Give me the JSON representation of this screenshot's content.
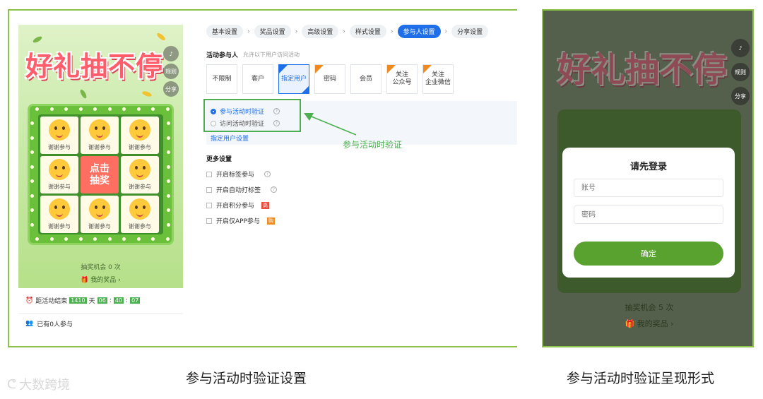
{
  "phone": {
    "title": "好礼抽不停",
    "side_buttons": [
      "♪",
      "规则",
      "分享"
    ],
    "cells": [
      "谢谢参与",
      "谢谢参与",
      "谢谢参与",
      "谢谢参与",
      "谢谢参与",
      "谢谢参与",
      "谢谢参与",
      "谢谢参与"
    ],
    "center_button": "点击抽奖",
    "chance_text": "抽奖机会 0 次",
    "my_prize": "我的奖品",
    "countdown_label": "距活动结束",
    "countdown": {
      "days": "1410",
      "day_unit": "天",
      "h": "06",
      "m": "40",
      "s": "07"
    },
    "participants": "已有0人参与"
  },
  "settings": {
    "steps": [
      "基本设置",
      "奖品设置",
      "高级设置",
      "样式设置",
      "参与人设置",
      "分享设置"
    ],
    "active_step": 4,
    "participants_label": "活动参与人",
    "participants_hint": "允许以下用户访问活动",
    "options": [
      "不限制",
      "客户",
      "指定用户",
      "密码",
      "会员",
      "关注公众号",
      "关注企业微信"
    ],
    "option_lines": [
      [
        "不限制"
      ],
      [
        "客户"
      ],
      [
        "指定用户"
      ],
      [
        "密码"
      ],
      [
        "会员"
      ],
      [
        "关注",
        "公众号"
      ],
      [
        "关注",
        "企业微信"
      ]
    ],
    "radios": [
      "参与活动时验证",
      "访问活动时验证"
    ],
    "link": "指定用户设置",
    "annotation": "参与活动时验证",
    "more_label": "更多设置",
    "checks": [
      "开启标签参与",
      "开启自动打标签",
      "开启积分参与",
      "开启仅APP参与"
    ],
    "badges": {
      "points": "高",
      "app": "购"
    },
    "colors": {
      "primary": "#1e6fe8",
      "highlight": "#4caf50",
      "tag": "#f0891e"
    }
  },
  "right": {
    "title": "好礼抽不停",
    "side_buttons": [
      "♪",
      "规则",
      "分享"
    ],
    "login_title": "请先登录",
    "account_placeholder": "账号",
    "password_placeholder": "密码",
    "confirm": "确定",
    "chance_text": "抽奖机会 5 次",
    "my_prize": "我的奖品"
  },
  "captions": {
    "left": "参与活动时验证设置",
    "right": "参与活动时验证呈现形式"
  },
  "watermark": "大数跨境"
}
